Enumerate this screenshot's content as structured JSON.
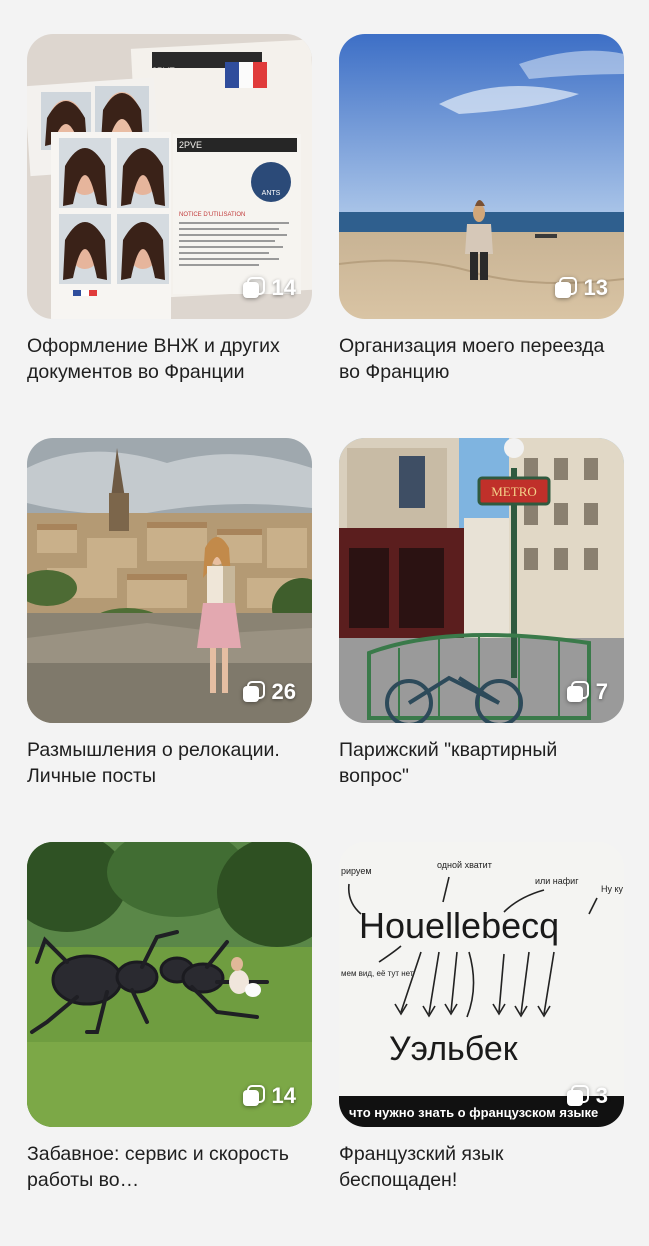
{
  "albums": [
    {
      "title": "Оформление ВНЖ и других документов во Франции",
      "count": "14",
      "icon": "gallery-stack-icon"
    },
    {
      "title": "Организация моего переезда во Францию",
      "count": "13",
      "icon": "gallery-stack-icon"
    },
    {
      "title": "Размышления о релокации. Личные посты",
      "count": "26",
      "icon": "gallery-stack-icon"
    },
    {
      "title": "Парижский \"квартирный вопрос\"",
      "count": "7",
      "icon": "gallery-stack-icon"
    },
    {
      "title": "Забавное: сервис и скорость работы во…",
      "count": "14",
      "icon": "gallery-stack-icon"
    },
    {
      "title": "Французский язык беспощаден!",
      "count": "3",
      "icon": "gallery-stack-icon"
    }
  ],
  "thumb_text": {
    "word_fr": "Houellebecq",
    "word_ru": "Уэльбек",
    "caption": "что нужно знать о французском языке",
    "notes": [
      "рируем",
      "одной хватит",
      "или нафиг",
      "Ну ку",
      "мем вид, её тут нет"
    ],
    "doc_code": "2PVE",
    "doc_heading": "NOTICE D'UTILISATION",
    "doc_seal": "ANTS",
    "metro_sign": "METRO"
  }
}
